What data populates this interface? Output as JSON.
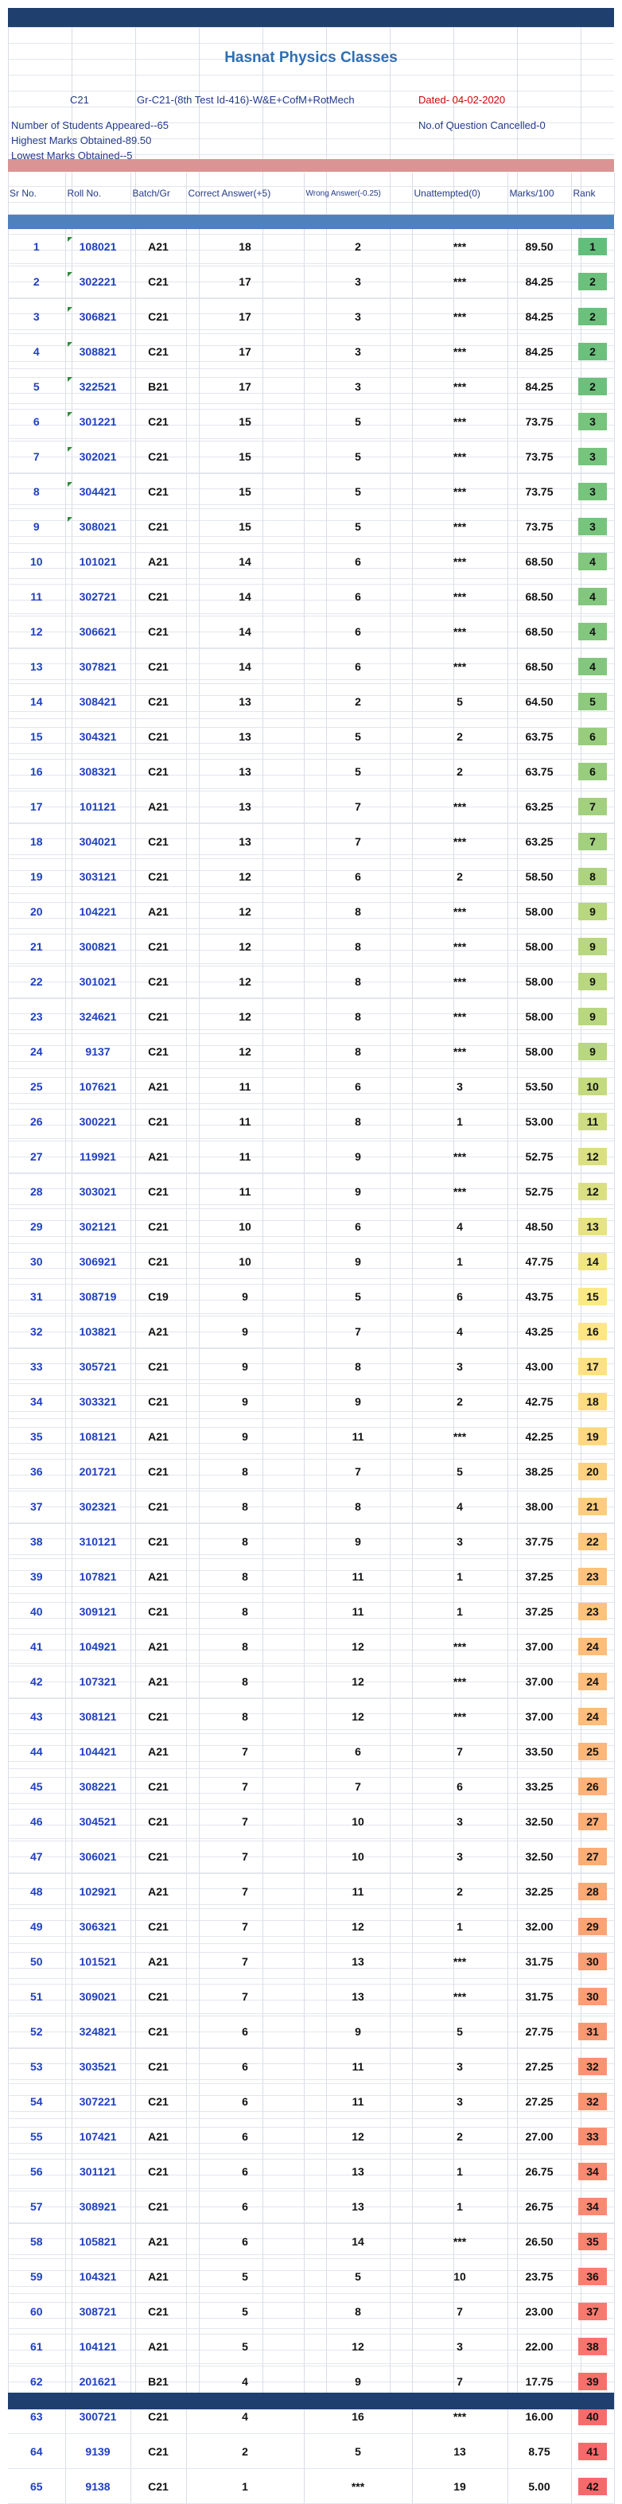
{
  "header": {
    "title": "Hasnat Physics Classes",
    "batch": "C21",
    "test_info": "Gr-C21-(8th Test Id-416)-W&E+CofM+RotMech",
    "date": "Dated- 04-02-2020",
    "students_appeared": "Number of Students Appeared--65",
    "questions_cancelled": "No.of Question Cancelled-0",
    "highest_marks": "Highest Marks Obtained-89.50",
    "lowest_marks": "Lowest Marks Obtained--5"
  },
  "columns": [
    "Sr No.",
    "Roll No.",
    "Batch/Gr",
    "Correct Answer(+5)",
    "Wrong Answer(-0.25)",
    "Unattempted(0)",
    "Marks/100",
    "Rank"
  ],
  "rows": [
    [
      "1",
      "108021",
      "A21",
      "18",
      "2",
      "***",
      "89.50",
      "1"
    ],
    [
      "2",
      "302221",
      "C21",
      "17",
      "3",
      "***",
      "84.25",
      "2"
    ],
    [
      "3",
      "306821",
      "C21",
      "17",
      "3",
      "***",
      "84.25",
      "2"
    ],
    [
      "4",
      "308821",
      "C21",
      "17",
      "3",
      "***",
      "84.25",
      "2"
    ],
    [
      "5",
      "322521",
      "B21",
      "17",
      "3",
      "***",
      "84.25",
      "2"
    ],
    [
      "6",
      "301221",
      "C21",
      "15",
      "5",
      "***",
      "73.75",
      "3"
    ],
    [
      "7",
      "302021",
      "C21",
      "15",
      "5",
      "***",
      "73.75",
      "3"
    ],
    [
      "8",
      "304421",
      "C21",
      "15",
      "5",
      "***",
      "73.75",
      "3"
    ],
    [
      "9",
      "308021",
      "C21",
      "15",
      "5",
      "***",
      "73.75",
      "3"
    ],
    [
      "10",
      "101021",
      "A21",
      "14",
      "6",
      "***",
      "68.50",
      "4"
    ],
    [
      "11",
      "302721",
      "C21",
      "14",
      "6",
      "***",
      "68.50",
      "4"
    ],
    [
      "12",
      "306621",
      "C21",
      "14",
      "6",
      "***",
      "68.50",
      "4"
    ],
    [
      "13",
      "307821",
      "C21",
      "14",
      "6",
      "***",
      "68.50",
      "4"
    ],
    [
      "14",
      "308421",
      "C21",
      "13",
      "2",
      "5",
      "64.50",
      "5"
    ],
    [
      "15",
      "304321",
      "C21",
      "13",
      "5",
      "2",
      "63.75",
      "6"
    ],
    [
      "16",
      "308321",
      "C21",
      "13",
      "5",
      "2",
      "63.75",
      "6"
    ],
    [
      "17",
      "101121",
      "A21",
      "13",
      "7",
      "***",
      "63.25",
      "7"
    ],
    [
      "18",
      "304021",
      "C21",
      "13",
      "7",
      "***",
      "63.25",
      "7"
    ],
    [
      "19",
      "303121",
      "C21",
      "12",
      "6",
      "2",
      "58.50",
      "8"
    ],
    [
      "20",
      "104221",
      "A21",
      "12",
      "8",
      "***",
      "58.00",
      "9"
    ],
    [
      "21",
      "300821",
      "C21",
      "12",
      "8",
      "***",
      "58.00",
      "9"
    ],
    [
      "22",
      "301021",
      "C21",
      "12",
      "8",
      "***",
      "58.00",
      "9"
    ],
    [
      "23",
      "324621",
      "C21",
      "12",
      "8",
      "***",
      "58.00",
      "9"
    ],
    [
      "24",
      "9137",
      "C21",
      "12",
      "8",
      "***",
      "58.00",
      "9"
    ],
    [
      "25",
      "107621",
      "A21",
      "11",
      "6",
      "3",
      "53.50",
      "10"
    ],
    [
      "26",
      "300221",
      "C21",
      "11",
      "8",
      "1",
      "53.00",
      "11"
    ],
    [
      "27",
      "119921",
      "A21",
      "11",
      "9",
      "***",
      "52.75",
      "12"
    ],
    [
      "28",
      "303021",
      "C21",
      "11",
      "9",
      "***",
      "52.75",
      "12"
    ],
    [
      "29",
      "302121",
      "C21",
      "10",
      "6",
      "4",
      "48.50",
      "13"
    ],
    [
      "30",
      "306921",
      "C21",
      "10",
      "9",
      "1",
      "47.75",
      "14"
    ],
    [
      "31",
      "308719",
      "C19",
      "9",
      "5",
      "6",
      "43.75",
      "15"
    ],
    [
      "32",
      "103821",
      "A21",
      "9",
      "7",
      "4",
      "43.25",
      "16"
    ],
    [
      "33",
      "305721",
      "C21",
      "9",
      "8",
      "3",
      "43.00",
      "17"
    ],
    [
      "34",
      "303321",
      "C21",
      "9",
      "9",
      "2",
      "42.75",
      "18"
    ],
    [
      "35",
      "108121",
      "A21",
      "9",
      "11",
      "***",
      "42.25",
      "19"
    ],
    [
      "36",
      "201721",
      "C21",
      "8",
      "7",
      "5",
      "38.25",
      "20"
    ],
    [
      "37",
      "302321",
      "C21",
      "8",
      "8",
      "4",
      "38.00",
      "21"
    ],
    [
      "38",
      "310121",
      "C21",
      "8",
      "9",
      "3",
      "37.75",
      "22"
    ],
    [
      "39",
      "107821",
      "A21",
      "8",
      "11",
      "1",
      "37.25",
      "23"
    ],
    [
      "40",
      "309121",
      "C21",
      "8",
      "11",
      "1",
      "37.25",
      "23"
    ],
    [
      "41",
      "104921",
      "A21",
      "8",
      "12",
      "***",
      "37.00",
      "24"
    ],
    [
      "42",
      "107321",
      "A21",
      "8",
      "12",
      "***",
      "37.00",
      "24"
    ],
    [
      "43",
      "308121",
      "C21",
      "8",
      "12",
      "***",
      "37.00",
      "24"
    ],
    [
      "44",
      "104421",
      "A21",
      "7",
      "6",
      "7",
      "33.50",
      "25"
    ],
    [
      "45",
      "308221",
      "C21",
      "7",
      "7",
      "6",
      "33.25",
      "26"
    ],
    [
      "46",
      "304521",
      "C21",
      "7",
      "10",
      "3",
      "32.50",
      "27"
    ],
    [
      "47",
      "306021",
      "C21",
      "7",
      "10",
      "3",
      "32.50",
      "27"
    ],
    [
      "48",
      "102921",
      "A21",
      "7",
      "11",
      "2",
      "32.25",
      "28"
    ],
    [
      "49",
      "306321",
      "C21",
      "7",
      "12",
      "1",
      "32.00",
      "29"
    ],
    [
      "50",
      "101521",
      "A21",
      "7",
      "13",
      "***",
      "31.75",
      "30"
    ],
    [
      "51",
      "309021",
      "C21",
      "7",
      "13",
      "***",
      "31.75",
      "30"
    ],
    [
      "52",
      "324821",
      "C21",
      "6",
      "9",
      "5",
      "27.75",
      "31"
    ],
    [
      "53",
      "303521",
      "C21",
      "6",
      "11",
      "3",
      "27.25",
      "32"
    ],
    [
      "54",
      "307221",
      "C21",
      "6",
      "11",
      "3",
      "27.25",
      "32"
    ],
    [
      "55",
      "107421",
      "A21",
      "6",
      "12",
      "2",
      "27.00",
      "33"
    ],
    [
      "56",
      "301121",
      "C21",
      "6",
      "13",
      "1",
      "26.75",
      "34"
    ],
    [
      "57",
      "308921",
      "C21",
      "6",
      "13",
      "1",
      "26.75",
      "34"
    ],
    [
      "58",
      "105821",
      "A21",
      "6",
      "14",
      "***",
      "26.50",
      "35"
    ],
    [
      "59",
      "104321",
      "A21",
      "5",
      "5",
      "10",
      "23.75",
      "36"
    ],
    [
      "60",
      "308721",
      "C21",
      "5",
      "8",
      "7",
      "23.00",
      "37"
    ],
    [
      "61",
      "104121",
      "A21",
      "5",
      "12",
      "3",
      "22.00",
      "38"
    ],
    [
      "62",
      "201621",
      "B21",
      "4",
      "9",
      "7",
      "17.75",
      "39"
    ],
    [
      "63",
      "300721",
      "C21",
      "4",
      "16",
      "***",
      "16.00",
      "40"
    ],
    [
      "64",
      "9139",
      "C21",
      "2",
      "5",
      "13",
      "8.75",
      "41"
    ],
    [
      "65",
      "9138",
      "C21",
      "1",
      "***",
      "19",
      "5.00",
      "42"
    ]
  ],
  "rank_colors": {
    "1": "#63be7b",
    "2": "#6cc07c",
    "3": "#77c47d",
    "4": "#82c77d",
    "5": "#8dca7e",
    "6": "#98cd7e",
    "7": "#a3d07f",
    "8": "#aed380",
    "9": "#b9d780",
    "10": "#c4da81",
    "11": "#cfdd82",
    "12": "#dae082",
    "13": "#e5e383",
    "14": "#f0e784",
    "15": "#fbea84",
    "16": "#fee683",
    "17": "#fee182",
    "18": "#fedc81",
    "19": "#fed780",
    "20": "#fdd17f",
    "21": "#fdcc7e",
    "22": "#fdc77d",
    "23": "#fdc27c",
    "24": "#fdbd7b",
    "25": "#fcb77a",
    "26": "#fcb279",
    "27": "#fcad78",
    "28": "#fca877",
    "29": "#fca376",
    "30": "#fb9d75",
    "31": "#fb9874",
    "32": "#fb9373",
    "33": "#fb8e72",
    "34": "#fa8971",
    "35": "#fa8370",
    "36": "#fa7e6f",
    "37": "#fa796e",
    "38": "#f9746d",
    "39": "#f96f6c",
    "40": "#f96b6b",
    "41": "#f8696b",
    "42": "#f8696b"
  },
  "flagged_rolls": [
    "108021",
    "302221",
    "306821",
    "308821",
    "322521",
    "301221",
    "302021",
    "304421",
    "308021"
  ]
}
